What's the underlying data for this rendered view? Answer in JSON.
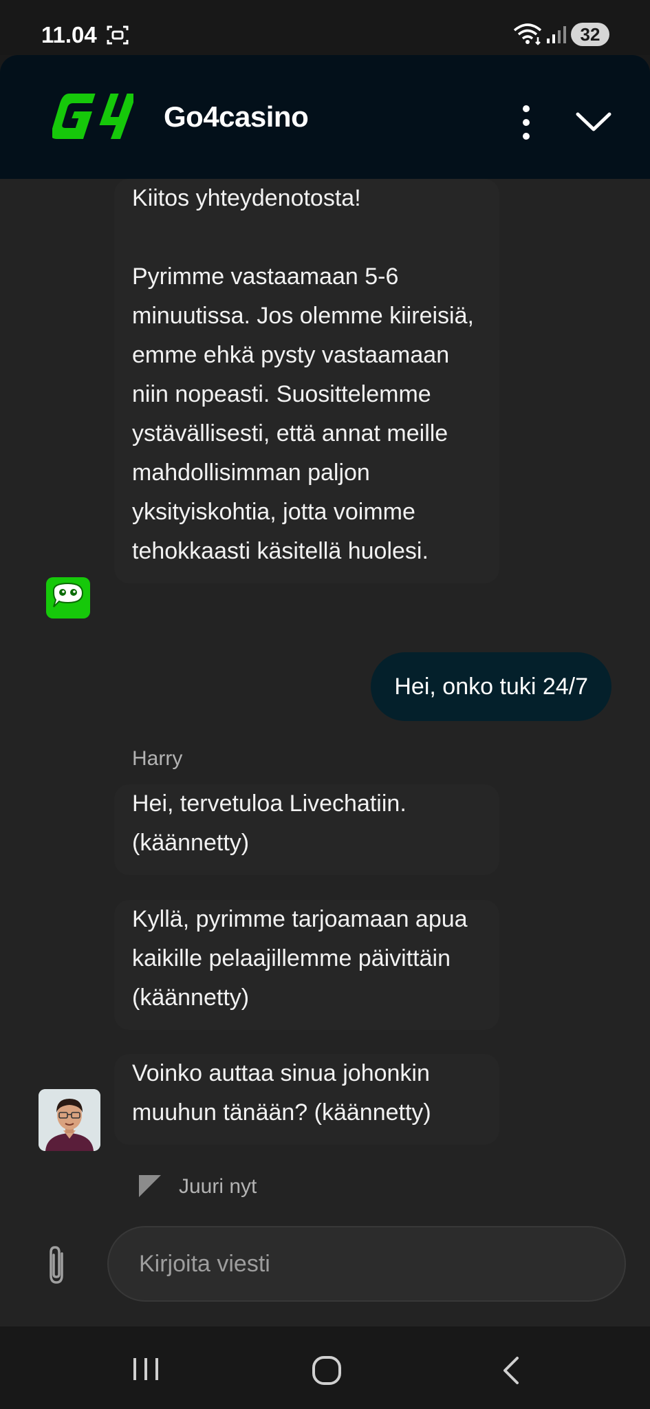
{
  "status_bar": {
    "time": "11.04",
    "battery": "32"
  },
  "header": {
    "logo_text": "G4",
    "title": "Go4casino"
  },
  "messages": {
    "bot_message": "Kiitos yhteydenotosta!\n\nPyrimme vastaamaan 5-6 minuutissa. Jos olemme kiireisiä, emme ehkä pysty vastaamaan niin nopeasti. Suosittelemme ystävällisesti, että annat meille mahdollisimman paljon yksityiskohtia, jotta voimme tehokkaasti käsitellä huolesi.",
    "user_message": "Hei, onko tuki 24/7",
    "agent_name": "Harry",
    "agent_messages": [
      "Hei, tervetuloa Livechatiin. (käännetty)",
      "Kyllä, pyrimme tarjoamaan apua kaikille pelaajillemme päivittäin (käännetty)",
      "Voinko auttaa sinua johonkin muuhun tänään? (käännetty)"
    ],
    "timestamp": "Juuri nyt"
  },
  "composer": {
    "placeholder": "Kirjoita viesti"
  },
  "colors": {
    "brand_green": "#16c80a",
    "header_bg": "#03101a",
    "user_bubble_bg": "#04202b"
  },
  "icons": [
    "screenshot-icon",
    "wifi-icon",
    "signal-icon",
    "more-vertical-icon",
    "chevron-down-icon",
    "chat-bubble-icon",
    "paperclip-icon",
    "recents-icon",
    "home-icon",
    "back-icon"
  ]
}
